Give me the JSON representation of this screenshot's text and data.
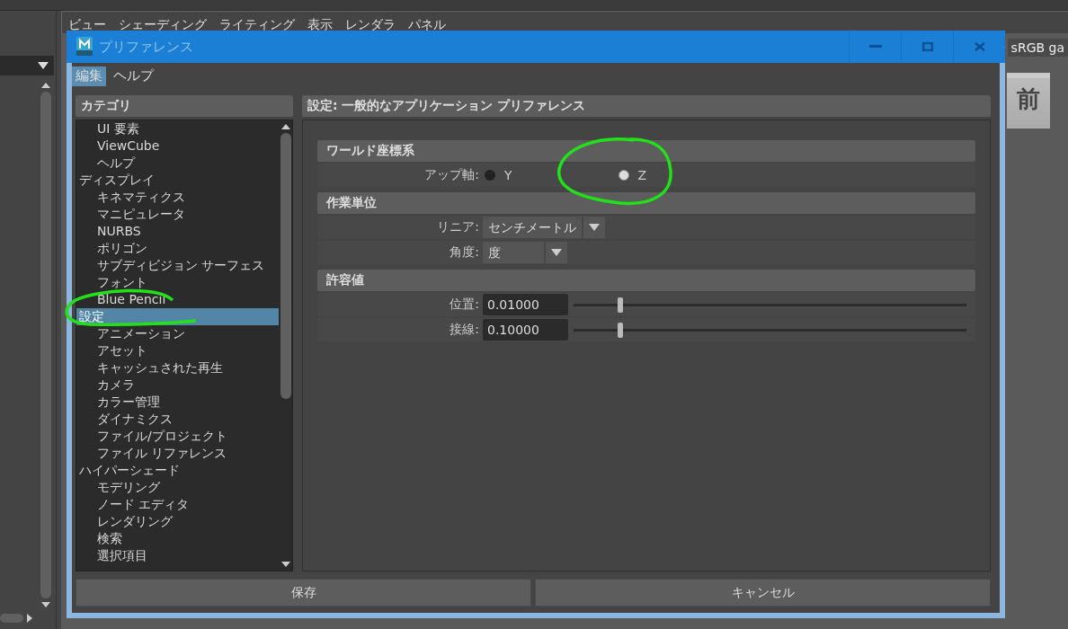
{
  "viewport_menu": [
    "ビュー",
    "シェーディング",
    "ライティング",
    "表示",
    "レンダラ",
    "パネル"
  ],
  "viewport_overlay": {
    "color_space": "sRGB ga",
    "viewcube_face": "前"
  },
  "dialog": {
    "title": "プリファレンス",
    "menu": [
      {
        "label": "編集",
        "selected": true
      },
      {
        "label": "ヘルプ",
        "selected": false
      }
    ],
    "categories": {
      "title": "カテゴリ",
      "continued_children": [
        {
          "label": "UI 要素",
          "selected": false
        },
        {
          "label": "ViewCube",
          "selected": false
        },
        {
          "label": "ヘルプ",
          "selected": false
        }
      ],
      "items": [
        {
          "label": "ディスプレイ",
          "selected": false,
          "children": [
            {
              "label": "キネマティクス",
              "selected": false
            },
            {
              "label": "マニピュレータ",
              "selected": false
            },
            {
              "label": "NURBS",
              "selected": false
            },
            {
              "label": "ポリゴン",
              "selected": false
            },
            {
              "label": "サブディビジョン サーフェス",
              "selected": false
            },
            {
              "label": "フォント",
              "selected": false
            },
            {
              "label": "Blue Pencil",
              "selected": false
            }
          ]
        },
        {
          "label": "設定",
          "selected": true,
          "children": [
            {
              "label": "アニメーション",
              "selected": false
            },
            {
              "label": "アセット",
              "selected": false
            },
            {
              "label": "キャッシュされた再生",
              "selected": false
            },
            {
              "label": "カメラ",
              "selected": false
            },
            {
              "label": "カラー管理",
              "selected": false
            },
            {
              "label": "ダイナミクス",
              "selected": false
            },
            {
              "label": "ファイル/プロジェクト",
              "selected": false
            },
            {
              "label": "ファイル リファレンス",
              "selected": false
            }
          ]
        },
        {
          "label": "ハイパーシェード",
          "selected": false,
          "children": [
            {
              "label": "モデリング",
              "selected": false
            },
            {
              "label": "ノード エディタ",
              "selected": false
            },
            {
              "label": "レンダリング",
              "selected": false
            },
            {
              "label": "検索",
              "selected": false
            },
            {
              "label": "選択項目",
              "selected": false
            }
          ]
        }
      ]
    },
    "settings": {
      "title": "設定: 一般的なアプリケーション プリファレンス",
      "sections": [
        {
          "title": "ワールド座標系",
          "rows": [
            {
              "kind": "radio",
              "label": "アップ軸:",
              "options": [
                {
                  "label": "Y",
                  "selected": false
                },
                {
                  "label": "Z",
                  "selected": true
                }
              ]
            }
          ]
        },
        {
          "title": "作業単位",
          "rows": [
            {
              "kind": "dropdown",
              "label": "リニア:",
              "value": "センチメートル"
            },
            {
              "kind": "dropdown",
              "label": "角度:",
              "value": "度"
            }
          ]
        },
        {
          "title": "許容値",
          "rows": [
            {
              "kind": "slider",
              "label": "位置:",
              "value": "0.01000",
              "level": 0.12
            },
            {
              "kind": "slider",
              "label": "接線:",
              "value": "0.10000",
              "level": 0.12
            }
          ]
        }
      ]
    },
    "buttons": [
      "保存",
      "キャンセル"
    ]
  }
}
